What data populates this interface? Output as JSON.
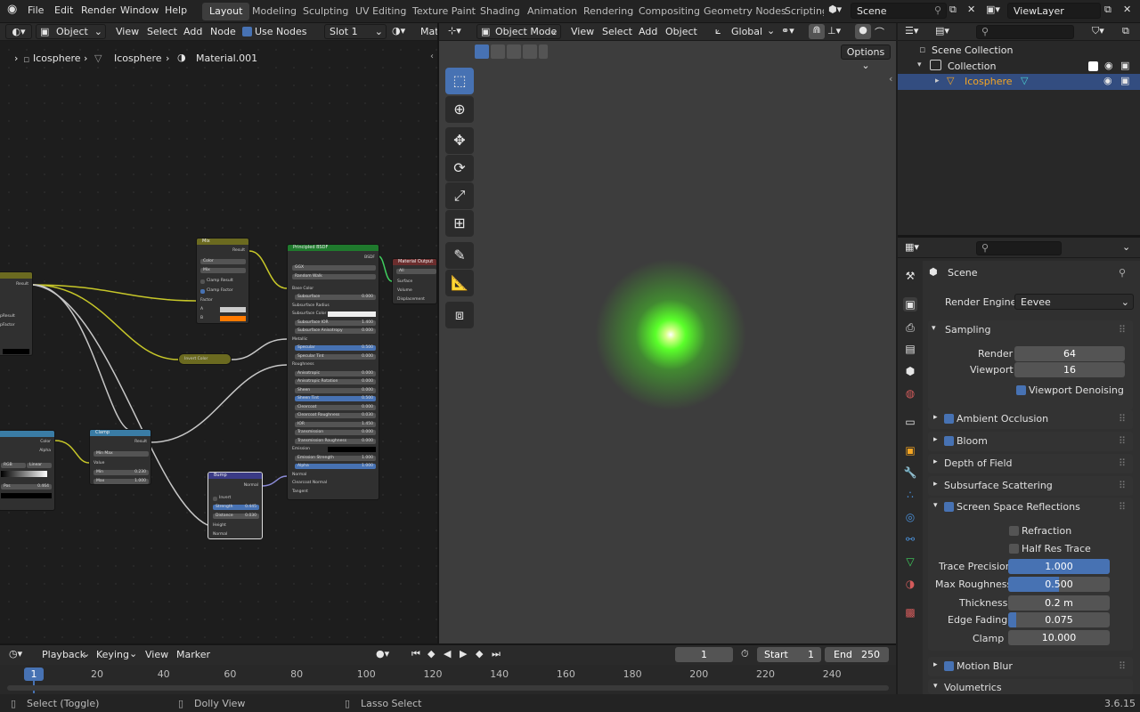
{
  "topmenu": {
    "file": "File",
    "edit": "Edit",
    "render": "Render",
    "window": "Window",
    "help": "Help"
  },
  "workspaces": [
    "Layout",
    "Modeling",
    "Sculpting",
    "UV Editing",
    "Texture Paint",
    "Shading",
    "Animation",
    "Rendering",
    "Compositing",
    "Geometry Nodes",
    "Scripting"
  ],
  "scene_name": "Scene",
  "view_layer": "ViewLayer",
  "node_editor": {
    "object_dropdown": "Object",
    "menu": [
      "View",
      "Select",
      "Add",
      "Node"
    ],
    "use_nodes_label": "Use Nodes",
    "slot": "Slot 1",
    "material_short": "Mat",
    "breadcrumb": [
      "Icosphere",
      "Icosphere",
      "Material.001"
    ]
  },
  "nodes": {
    "mix": {
      "title": "Mix",
      "output": "Result",
      "type": "Color",
      "mode": "Mix",
      "clamp_result": "Clamp Result",
      "clamp_factor": "Clamp Factor",
      "factor": "Factor",
      "a": "A",
      "b": "B",
      "b_color": "#ff7a00"
    },
    "principled": {
      "title": "Principled BSDF",
      "output": "BSDF",
      "dist": "GGX",
      "sss": "Random Walk",
      "base_color": "Base Color",
      "rows": [
        {
          "label": "Subsurface",
          "value": "0.000"
        },
        {
          "label": "Subsurface Radius",
          "value": ""
        },
        {
          "label": "Subsurface Color",
          "value": ""
        },
        {
          "label": "Subsurface IOR",
          "value": "1.400"
        },
        {
          "label": "Subsurface Anisotropy",
          "value": "0.000"
        },
        {
          "label": "Metallic",
          "value": ""
        },
        {
          "label": "Specular",
          "value": "0.500"
        },
        {
          "label": "Specular Tint",
          "value": "0.000"
        },
        {
          "label": "Roughness",
          "value": ""
        },
        {
          "label": "Anisotropic",
          "value": "0.000"
        },
        {
          "label": "Anisotropic Rotation",
          "value": "0.000"
        },
        {
          "label": "Sheen",
          "value": "0.000"
        },
        {
          "label": "Sheen Tint",
          "value": "0.500"
        },
        {
          "label": "Clearcoat",
          "value": "0.000"
        },
        {
          "label": "Clearcoat Roughness",
          "value": "0.030"
        },
        {
          "label": "IOR",
          "value": "1.450"
        },
        {
          "label": "Transmission",
          "value": "0.000"
        },
        {
          "label": "Transmission Roughness",
          "value": "0.000"
        },
        {
          "label": "Emission",
          "value": ""
        },
        {
          "label": "Emission Strength",
          "value": "1.000"
        },
        {
          "label": "Alpha",
          "value": "1.000"
        },
        {
          "label": "Normal",
          "value": ""
        },
        {
          "label": "Clearcoat Normal",
          "value": ""
        },
        {
          "label": "Tangent",
          "value": ""
        }
      ]
    },
    "output": {
      "title": "Material Output",
      "target": "All",
      "surface": "Surface",
      "volume": "Volume",
      "displacement": "Displacement"
    },
    "invert": {
      "title": "Invert Color"
    },
    "clamp": {
      "title": "Clamp",
      "output": "Result",
      "mode": "Min Max",
      "value": "Value",
      "min_label": "Min",
      "min": "0.230",
      "max_label": "Max",
      "max": "1.000"
    },
    "bump": {
      "title": "Bump",
      "output": "Normal",
      "invert": "Invert",
      "strength_label": "Strength",
      "strength": "0.445",
      "distance_label": "Distance",
      "distance": "0.030",
      "height": "Height",
      "normal": "Normal"
    },
    "ramp": {
      "color": "Color",
      "alpha": "Alpha",
      "mode": "RGB",
      "interp": "Linear",
      "pos_label": "Pos",
      "pos": "0.464"
    },
    "partial_left": {
      "result": "Result",
      "clamp_result": "pResult",
      "factor": "pFactor"
    }
  },
  "viewport": {
    "mode": "Object Mode",
    "menu": [
      "View",
      "Select",
      "Add",
      "Object"
    ],
    "orientation": "Global",
    "options": "Options",
    "glow_color": "#5aff2a"
  },
  "outliner": {
    "scene_collection": "Scene Collection",
    "collection": "Collection",
    "object": "Icosphere"
  },
  "properties": {
    "context": "Scene",
    "render_engine_label": "Render Engine",
    "render_engine": "Eevee",
    "sampling": {
      "title": "Sampling",
      "render_label": "Render",
      "render": "64",
      "viewport_label": "Viewport",
      "viewport": "16",
      "denoise": "Viewport Denoising"
    },
    "panels": [
      "Ambient Occlusion",
      "Bloom",
      "Depth of Field",
      "Subsurface Scattering"
    ],
    "ssr": {
      "title": "Screen Space Reflections",
      "refraction": "Refraction",
      "half_res": "Half Res Trace",
      "trace_precision_label": "Trace Precision",
      "trace_precision": "1.000",
      "trace_precision_fraction": 1.0,
      "max_roughness_label": "Max Roughness",
      "max_roughness": "0.500",
      "max_roughness_fraction": 0.5,
      "thickness_label": "Thickness",
      "thickness": "0.2 m",
      "edge_fading_label": "Edge Fading",
      "edge_fading": "0.075",
      "edge_fading_fraction": 0.075,
      "clamp_label": "Clamp",
      "clamp": "10.000"
    },
    "motion_blur": "Motion Blur",
    "volumetrics": "Volumetrics"
  },
  "timeline": {
    "menus": [
      "Playback",
      "Keying",
      "View",
      "Marker"
    ],
    "current_frame": "1",
    "start_label": "Start",
    "start": "1",
    "end_label": "End",
    "end": "250",
    "ticks": [
      "20",
      "40",
      "60",
      "80",
      "100",
      "120",
      "140",
      "160",
      "180",
      "200",
      "220",
      "240"
    ],
    "playhead": "1"
  },
  "statusbar": {
    "select": "Select (Toggle)",
    "dolly": "Dolly View",
    "lasso": "Lasso Select",
    "version": "3.6.15"
  }
}
